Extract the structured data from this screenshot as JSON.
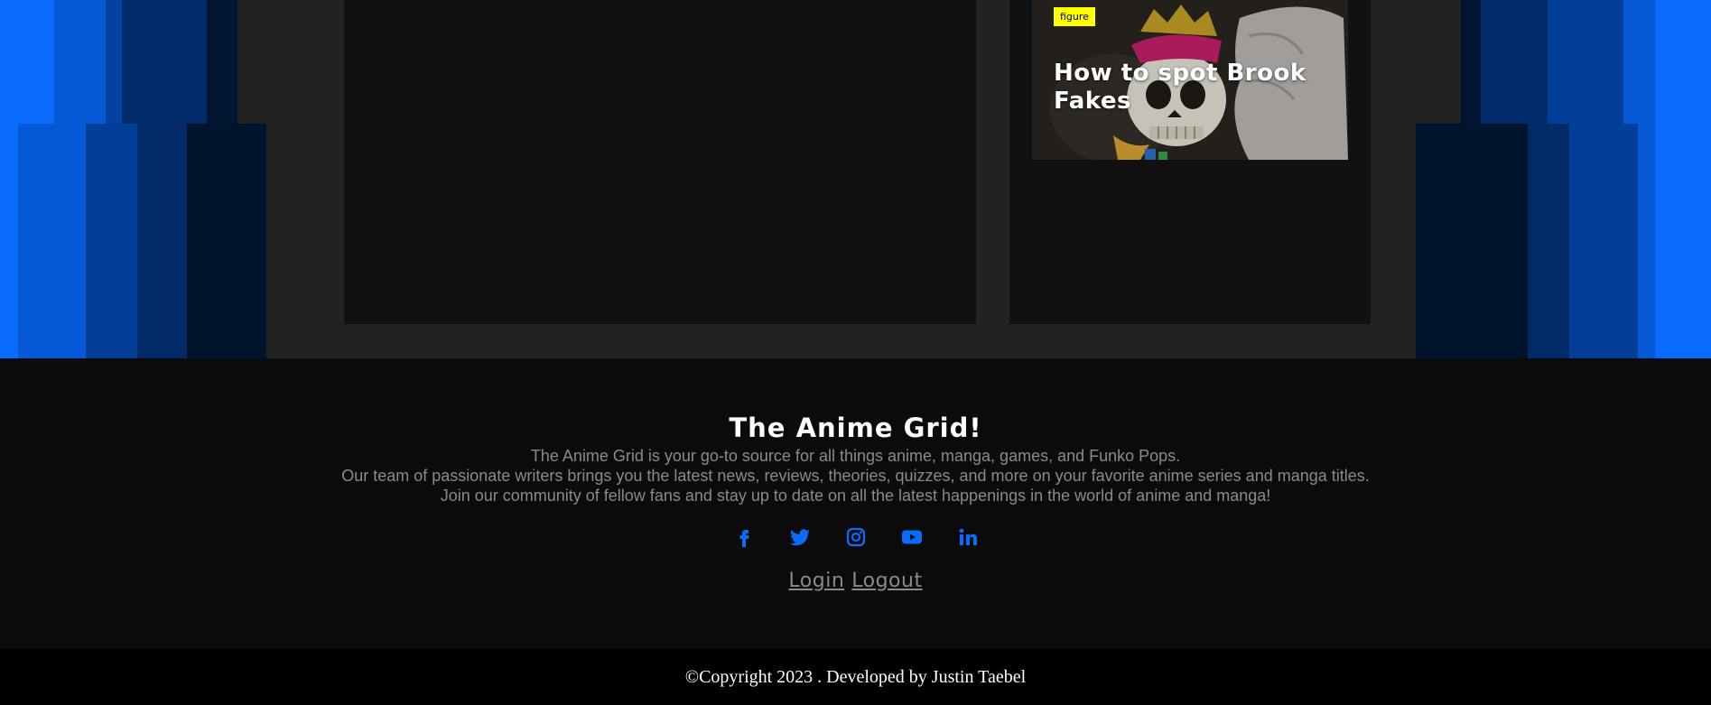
{
  "colors": {
    "accent_blue": "#0a6cff",
    "background": "#0b0b0b",
    "panel": "#111111",
    "band": "#222222",
    "tag_yellow": "#ffff00"
  },
  "featured_card": {
    "tag": "figure",
    "title": "How to spot Brook Fakes"
  },
  "footer": {
    "title": "The Anime Grid!",
    "description": [
      "The Anime Grid is your go-to source for all things anime, manga, games, and Funko Pops.",
      "Our team of passionate writers brings you the latest news, reviews, theories, quizzes, and more on your favorite anime series and manga titles.",
      "Join our community of fellow fans and stay up to date on all the latest happenings in the world of anime and manga!"
    ],
    "social_icons": [
      "facebook-icon",
      "twitter-icon",
      "instagram-icon",
      "youtube-icon",
      "linkedin-icon"
    ],
    "login_label": "Login",
    "logout_label": "Logout"
  },
  "copyright": {
    "symbol": "©",
    "text": "Copyright 2023 . Developed by Justin Taebel"
  }
}
